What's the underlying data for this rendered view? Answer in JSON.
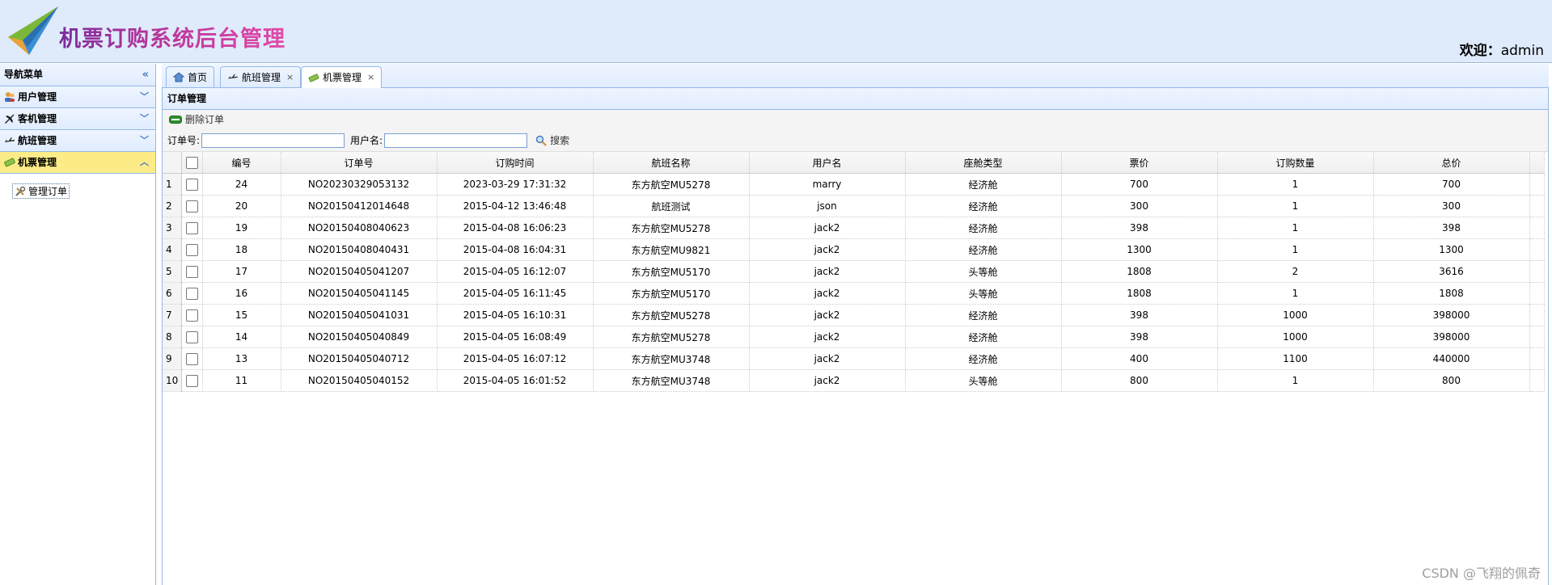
{
  "header": {
    "app_title": "机票订购系统后台管理",
    "welcome_label": "欢迎：",
    "username": "admin",
    "brand_colors": {
      "title_start": "#7a2d9e",
      "title_end": "#e24aa8",
      "plane": "#7bb83a"
    }
  },
  "nav": {
    "title": "导航菜单",
    "collapse_icon": "double-chevron-left-icon",
    "items": [
      {
        "label": "用户管理",
        "icon": "users-icon",
        "active": false
      },
      {
        "label": "客机管理",
        "icon": "airplane-icon",
        "active": false
      },
      {
        "label": "航班管理",
        "icon": "flight-icon",
        "active": false
      },
      {
        "label": "机票管理",
        "icon": "ticket-icon",
        "active": true
      }
    ],
    "sub_items": [
      {
        "label": "管理订单",
        "icon": "tools-icon"
      }
    ]
  },
  "tabs": [
    {
      "label": "首页",
      "icon": "home-icon",
      "closable": false,
      "active": false
    },
    {
      "label": "航班管理",
      "icon": "flight-icon",
      "closable": true,
      "active": false
    },
    {
      "label": "机票管理",
      "icon": "ticket-icon",
      "closable": true,
      "active": true
    }
  ],
  "panel": {
    "title": "订单管理",
    "toolbar": {
      "delete_label": "删除订单"
    },
    "search": {
      "order_no_label": "订单号:",
      "order_no_value": "",
      "username_label": "用户名:",
      "username_value": "",
      "search_label": "搜索"
    }
  },
  "grid": {
    "columns": [
      "编号",
      "订单号",
      "订购时间",
      "航班名称",
      "用户名",
      "座舱类型",
      "票价",
      "订购数量",
      "总价"
    ],
    "rows": [
      {
        "n": "1",
        "id": "24",
        "order_no": "NO20230329053132",
        "time": "2023-03-29 17:31:32",
        "flight": "东方航空MU5278",
        "user": "marry",
        "cabin": "经济舱",
        "price": "700",
        "qty": "1",
        "total": "700"
      },
      {
        "n": "2",
        "id": "20",
        "order_no": "NO20150412014648",
        "time": "2015-04-12 13:46:48",
        "flight": "航班测试",
        "user": "json",
        "cabin": "经济舱",
        "price": "300",
        "qty": "1",
        "total": "300"
      },
      {
        "n": "3",
        "id": "19",
        "order_no": "NO20150408040623",
        "time": "2015-04-08 16:06:23",
        "flight": "东方航空MU5278",
        "user": "jack2",
        "cabin": "经济舱",
        "price": "398",
        "qty": "1",
        "total": "398"
      },
      {
        "n": "4",
        "id": "18",
        "order_no": "NO20150408040431",
        "time": "2015-04-08 16:04:31",
        "flight": "东方航空MU9821",
        "user": "jack2",
        "cabin": "经济舱",
        "price": "1300",
        "qty": "1",
        "total": "1300"
      },
      {
        "n": "5",
        "id": "17",
        "order_no": "NO20150405041207",
        "time": "2015-04-05 16:12:07",
        "flight": "东方航空MU5170",
        "user": "jack2",
        "cabin": "头等舱",
        "price": "1808",
        "qty": "2",
        "total": "3616"
      },
      {
        "n": "6",
        "id": "16",
        "order_no": "NO20150405041145",
        "time": "2015-04-05 16:11:45",
        "flight": "东方航空MU5170",
        "user": "jack2",
        "cabin": "头等舱",
        "price": "1808",
        "qty": "1",
        "total": "1808"
      },
      {
        "n": "7",
        "id": "15",
        "order_no": "NO20150405041031",
        "time": "2015-04-05 16:10:31",
        "flight": "东方航空MU5278",
        "user": "jack2",
        "cabin": "经济舱",
        "price": "398",
        "qty": "1000",
        "total": "398000"
      },
      {
        "n": "8",
        "id": "14",
        "order_no": "NO20150405040849",
        "time": "2015-04-05 16:08:49",
        "flight": "东方航空MU5278",
        "user": "jack2",
        "cabin": "经济舱",
        "price": "398",
        "qty": "1000",
        "total": "398000"
      },
      {
        "n": "9",
        "id": "13",
        "order_no": "NO20150405040712",
        "time": "2015-04-05 16:07:12",
        "flight": "东方航空MU3748",
        "user": "jack2",
        "cabin": "经济舱",
        "price": "400",
        "qty": "1100",
        "total": "440000"
      },
      {
        "n": "10",
        "id": "11",
        "order_no": "NO20150405040152",
        "time": "2015-04-05 16:01:52",
        "flight": "东方航空MU3748",
        "user": "jack2",
        "cabin": "头等舱",
        "price": "800",
        "qty": "1",
        "total": "800"
      }
    ]
  },
  "watermark": "CSDN @飞翔的佩奇"
}
